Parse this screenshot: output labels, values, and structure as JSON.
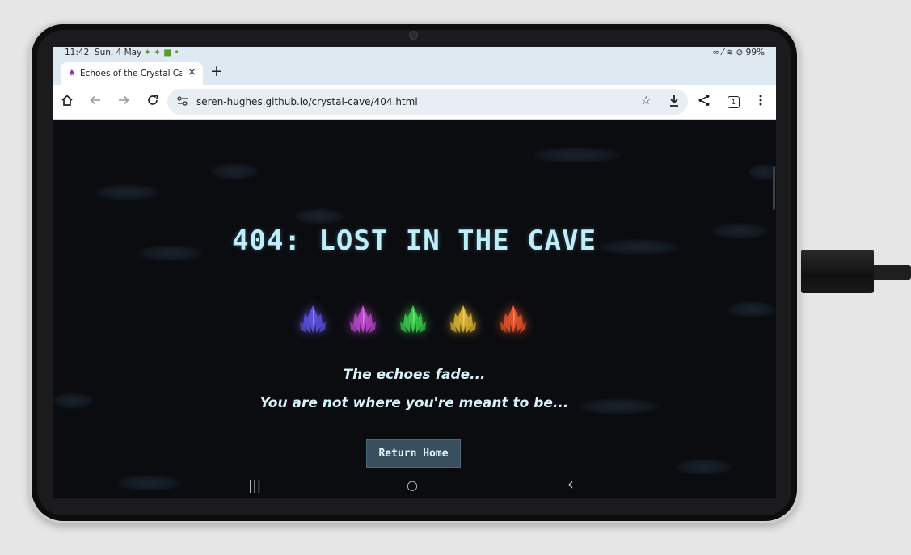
{
  "status_bar": {
    "time": "11:42",
    "date": "Sun, 4 May",
    "notification_icons": "✦ ✦ ■ •",
    "right": "∞ ⁄ ≋ ⊘ 99%"
  },
  "tab": {
    "title": "Echoes of the Crystal Cave |",
    "close": "×",
    "new_tab": "+"
  },
  "toolbar": {
    "home_icon": "home-icon",
    "back_icon": "back-arrow-icon",
    "forward_icon": "forward-arrow-icon",
    "reload_icon": "reload-icon",
    "url": "seren-hughes.github.io/crystal-cave/404.html",
    "tab_count": "1"
  },
  "page": {
    "title": "404: LOST IN THE CAVE",
    "crystal_colors": [
      "#5b4fd6",
      "#b547c9",
      "#39c64a",
      "#d6b032",
      "#e2522a"
    ],
    "line1": "The echoes fade...",
    "line2": "You are not where you're meant to be...",
    "button_label": "Return Home"
  },
  "nav_bar": {
    "recents": "|||",
    "home": "○",
    "back": "‹"
  }
}
